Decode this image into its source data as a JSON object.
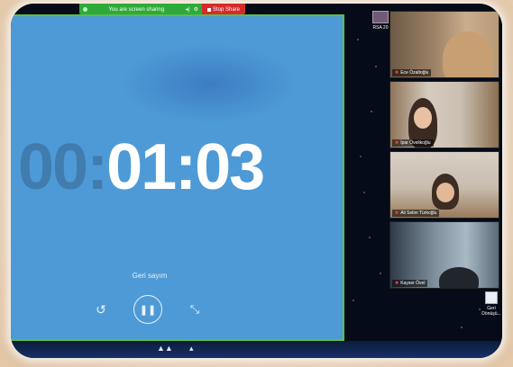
{
  "share_bar": {
    "status_text": "You are screen sharing",
    "stop_label": "Stop Share"
  },
  "clock": {
    "timer_faded": "00:",
    "timer_main": "01:03",
    "caption": "Geri sayım"
  },
  "sidebar": {
    "rsa_label": "RSA 20",
    "participants": [
      {
        "name": "Ece Özaltoğlu"
      },
      {
        "name": "İpar Övelikoğlu"
      },
      {
        "name": "Ali Selim Türkoğlu"
      },
      {
        "name": "Kayser Övel"
      }
    ],
    "geri_label": "Geri Dönüşü..."
  },
  "colors": {
    "share_green": "#2eaa3a",
    "stop_red": "#d52b2b",
    "clock_bg": "#4e9ad6",
    "window_border": "#59c23e"
  },
  "icons": {
    "reset": "rotate-ccw-icon",
    "pause": "pause-icon",
    "minimize": "collapse-arrows-icon"
  }
}
